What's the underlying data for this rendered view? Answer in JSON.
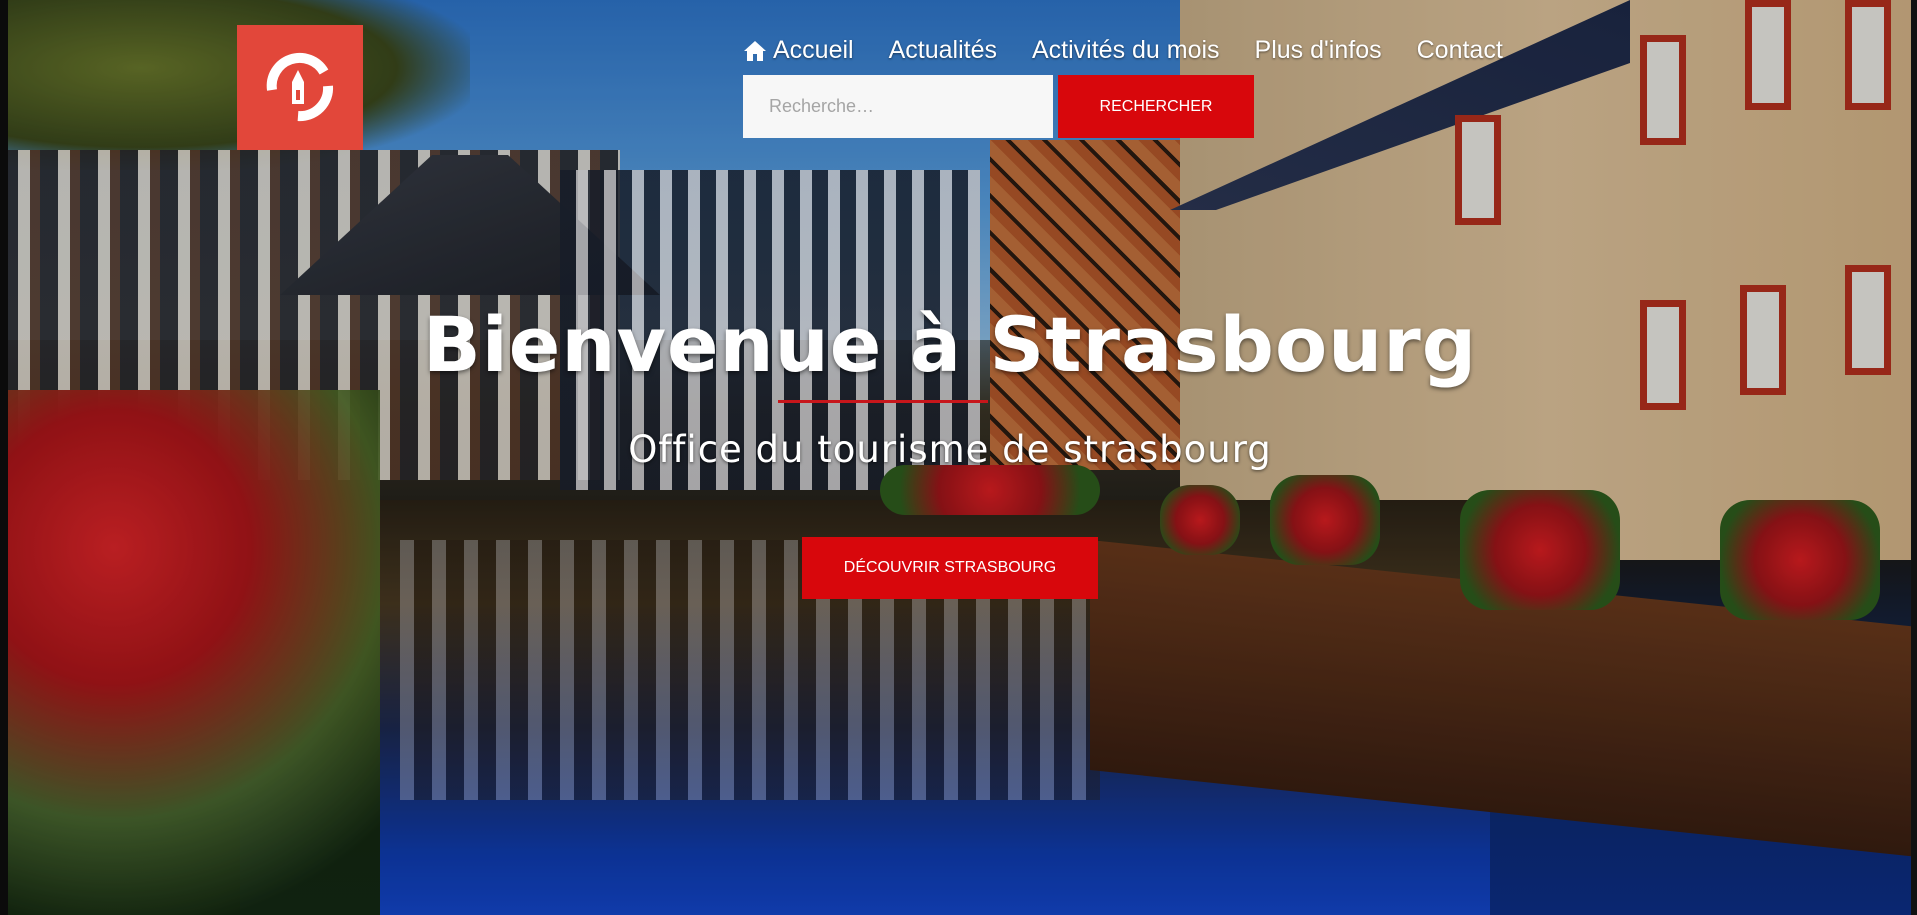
{
  "nav": {
    "items": [
      {
        "label": "Accueil",
        "icon": "home-icon"
      },
      {
        "label": "Actualités"
      },
      {
        "label": "Activités du mois"
      },
      {
        "label": "Plus d'infos"
      },
      {
        "label": "Contact"
      }
    ]
  },
  "search": {
    "placeholder": "Recherche…",
    "button_label": "RECHERCHER"
  },
  "hero": {
    "title": "Bienvenue à Strasbourg",
    "subtitle": "Office du tourisme de strasbourg",
    "cta_label": "DÉCOUVRIR STRASBOURG"
  },
  "colors": {
    "brand": "#e2473a",
    "accent": "#d8070c"
  }
}
